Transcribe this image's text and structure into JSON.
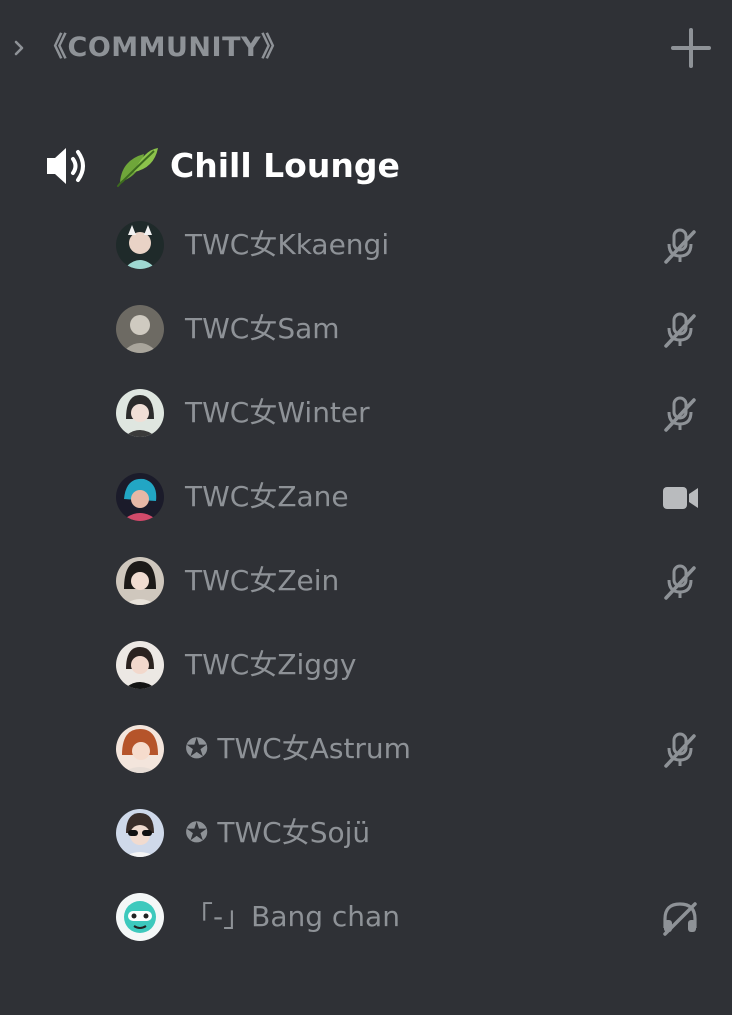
{
  "category": {
    "label": "《COMMUNITY》",
    "collapse_icon": "chevron-right-icon",
    "add_icon": "plus-icon"
  },
  "channel": {
    "name": "Chill Lounge",
    "type_icon": "speaker-icon",
    "emoji_icon": "leaf-icon"
  },
  "members": [
    {
      "name": "TWC女Kkaengi",
      "status": "mic-muted-icon"
    },
    {
      "name": "TWC女Sam",
      "status": "mic-muted-icon"
    },
    {
      "name": "TWC女Winter",
      "status": "mic-muted-icon"
    },
    {
      "name": "TWC女Zane",
      "status": "video-camera-icon"
    },
    {
      "name": "TWC女Zein",
      "status": "mic-muted-icon"
    },
    {
      "name": "TWC女Ziggy",
      "status": ""
    },
    {
      "name": "✪ TWC女Astrum",
      "status": "mic-muted-icon"
    },
    {
      "name": "✪ TWC女Sojü",
      "status": ""
    },
    {
      "name": "「-」Bang chan",
      "status": "headphones-deafened-icon"
    }
  ],
  "colors": {
    "background": "#2f3136",
    "muted_text": "#8e9297",
    "channel_text": "#ffffff",
    "icon": "#b9bbbe"
  }
}
